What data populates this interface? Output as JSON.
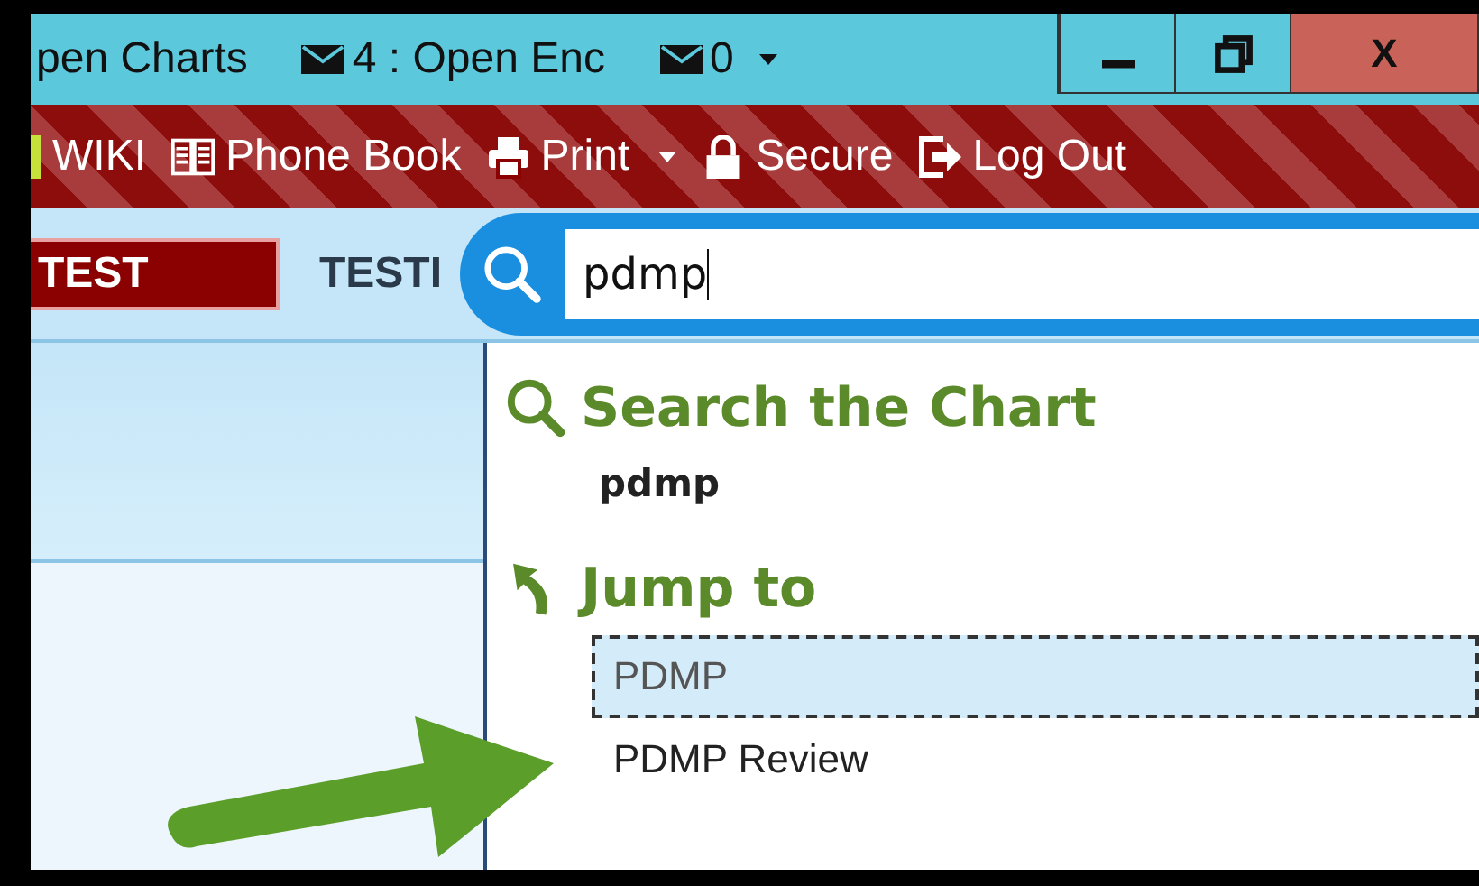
{
  "title_bar": {
    "items": [
      {
        "kind": "text",
        "label": "pen Charts"
      },
      {
        "kind": "mail",
        "label": "4 : Open Enc"
      },
      {
        "kind": "mail_dropdown",
        "label": "0"
      }
    ],
    "close_label": "X"
  },
  "toolbar": {
    "items": [
      {
        "kind": "wiki",
        "label": "WIKI",
        "dropdown": false
      },
      {
        "kind": "book",
        "label": "Phone Book",
        "dropdown": false
      },
      {
        "kind": "print",
        "label": "Print",
        "dropdown": true
      },
      {
        "kind": "lock",
        "label": "Secure",
        "dropdown": false
      },
      {
        "kind": "logout",
        "label": "Log Out",
        "dropdown": false
      }
    ]
  },
  "patient_tabs": [
    {
      "label": "TEST",
      "selected": true
    },
    {
      "label": "TESTI",
      "selected": false
    }
  ],
  "search": {
    "value": "pdmp"
  },
  "results": {
    "sections": [
      {
        "kind": "search",
        "heading": "Search the Chart",
        "items": [
          {
            "label": "pdmp",
            "selected": false
          }
        ]
      },
      {
        "kind": "jump",
        "heading": "Jump to",
        "items": [
          {
            "label": "PDMP",
            "selected": true
          },
          {
            "label": "PDMP Review",
            "selected": false
          }
        ]
      }
    ]
  }
}
